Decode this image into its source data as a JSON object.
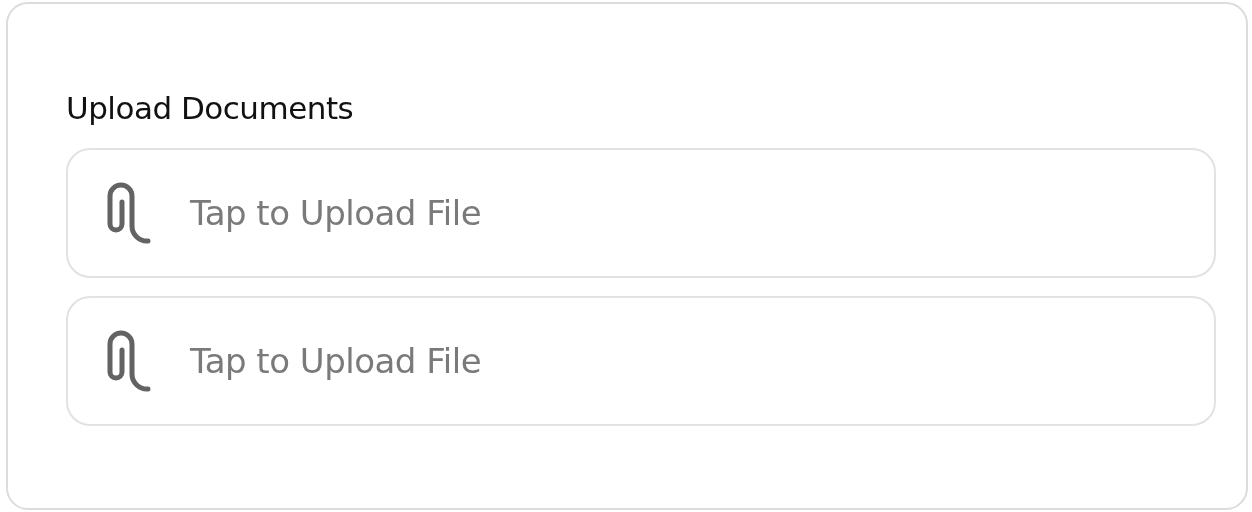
{
  "section": {
    "title": "Upload Documents",
    "uploads": [
      {
        "label": "Tap to Upload File"
      },
      {
        "label": "Tap to Upload File"
      }
    ]
  }
}
